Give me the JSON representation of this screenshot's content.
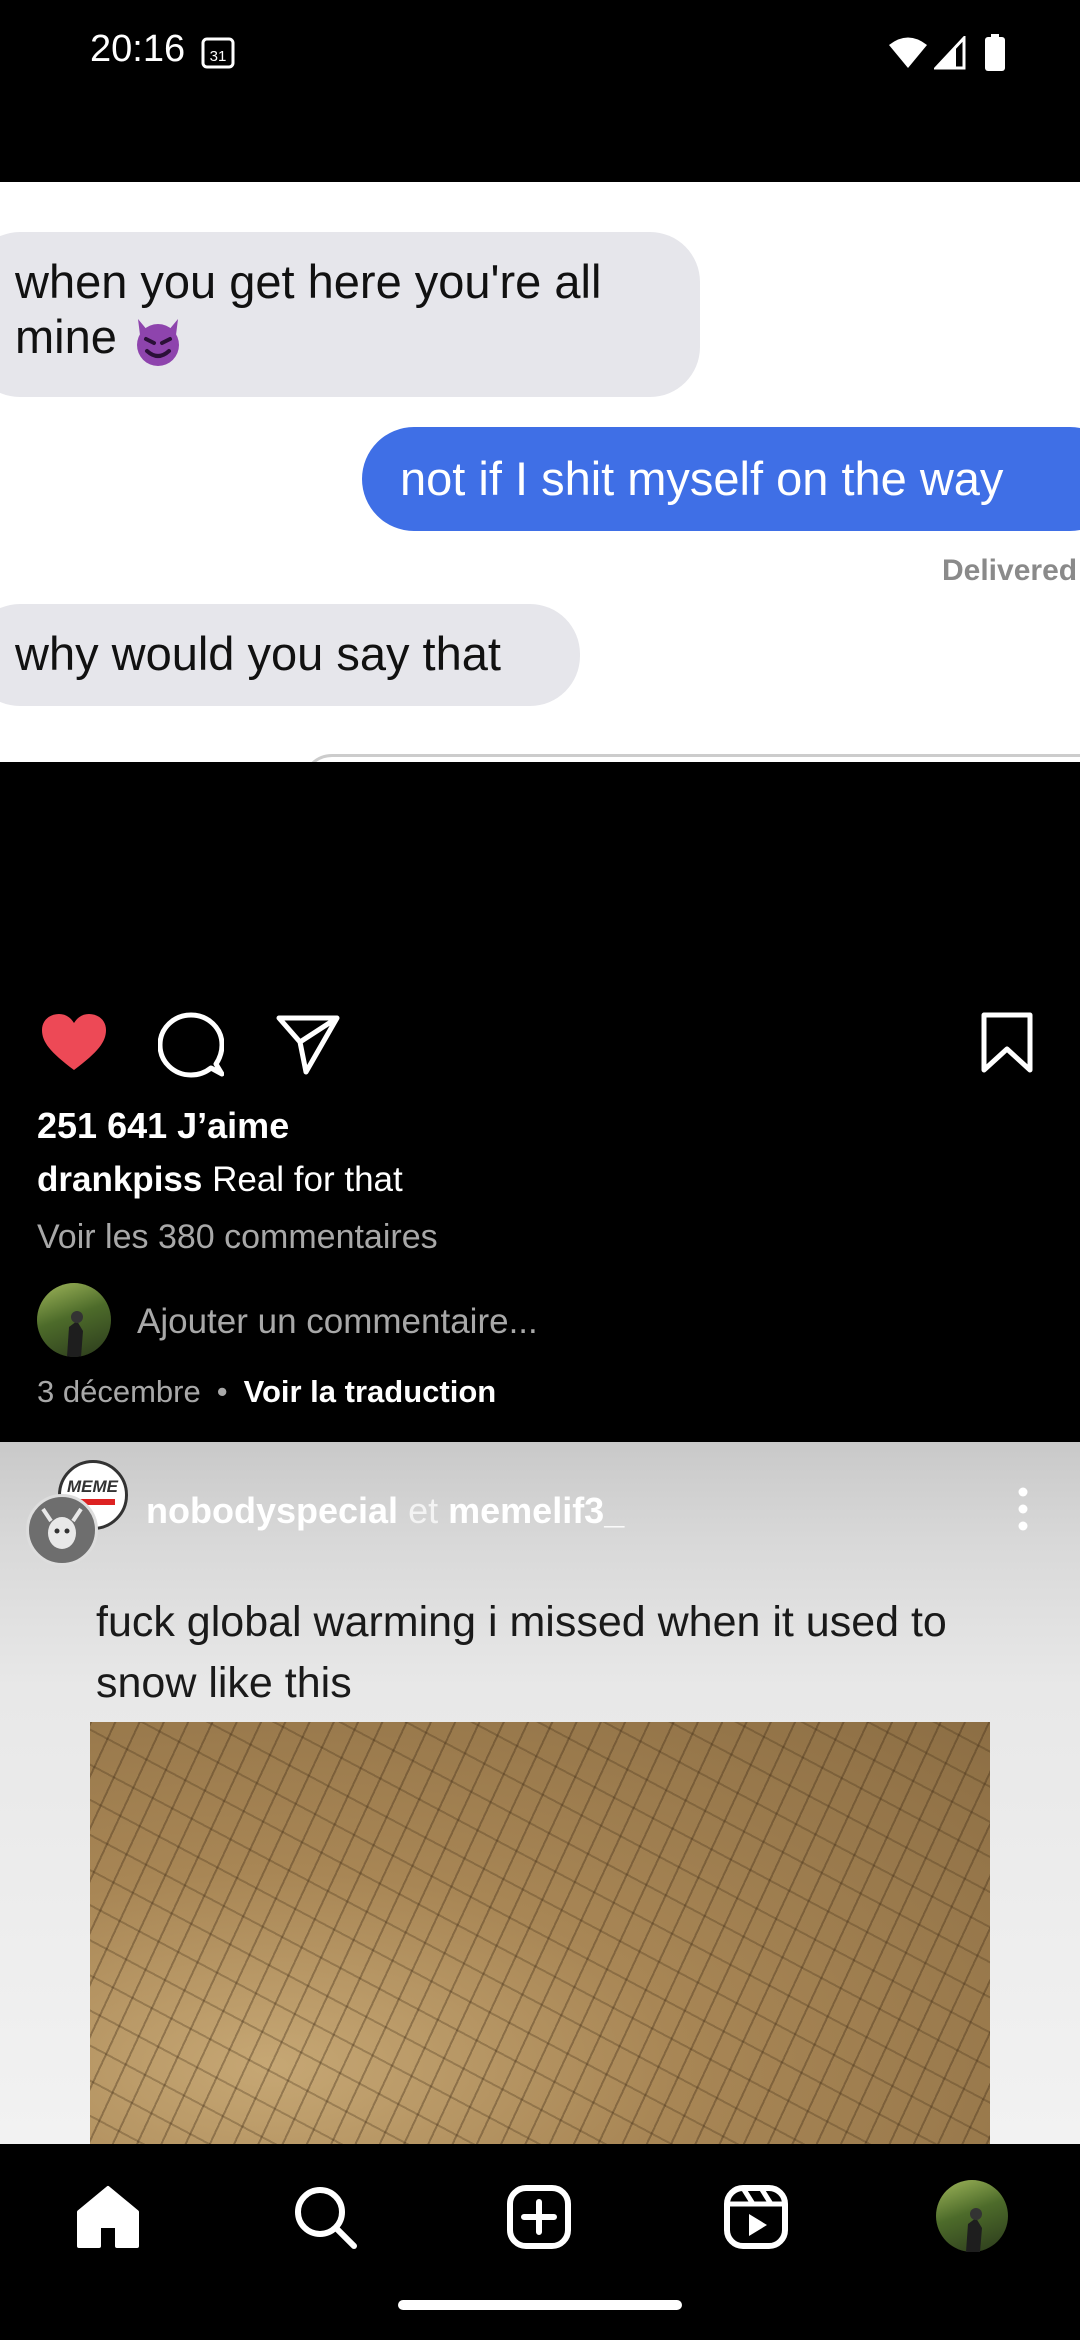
{
  "status_bar": {
    "time": "20:16",
    "calendar_day": "31"
  },
  "post1": {
    "messages": [
      {
        "text": "when you get here you're all mine"
      },
      {
        "text": "not if I shit myself on the way"
      },
      {
        "status": "Delivered"
      },
      {
        "text": "why would you say that"
      }
    ],
    "likes": "251 641 J’aime",
    "username": "drankpiss",
    "caption": "Real for that",
    "view_comments": "Voir les 380 commentaires",
    "add_comment_placeholder": "Ajouter un commentaire...",
    "date": "3 décembre",
    "separator": "•",
    "translate": "Voir la traduction",
    "liked": true,
    "like_color": "#ed4956"
  },
  "post2": {
    "user1": "nobodyspecial",
    "conjunction": "et",
    "user2": "memelif3_",
    "avatar_label": "MEME",
    "text": "fuck global warming i missed when it used to snow like this"
  },
  "bottom_nav": {
    "items": [
      "home-icon",
      "search-icon",
      "create-icon",
      "reels-icon",
      "profile-avatar"
    ],
    "active": "home"
  }
}
